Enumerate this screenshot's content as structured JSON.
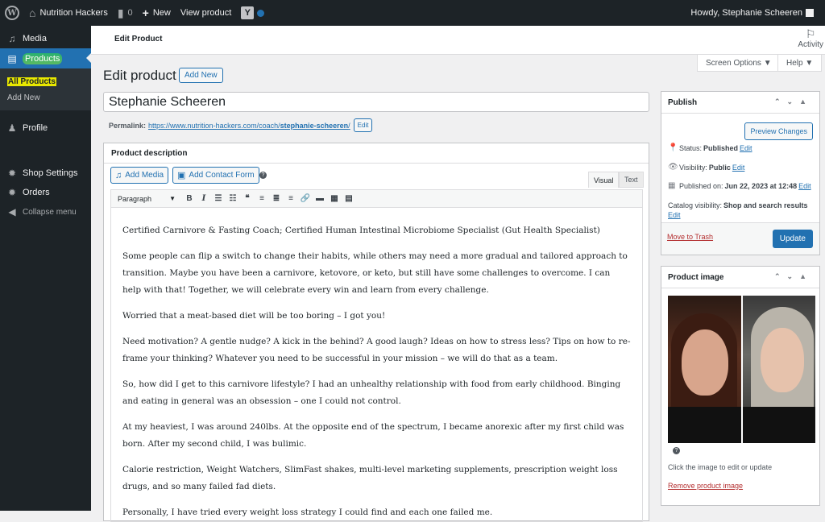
{
  "admin_bar": {
    "site_name": "Nutrition Hackers",
    "comments_count": "0",
    "new_label": "New",
    "view_label": "View product",
    "howdy": "Howdy, Stephanie Scheeren"
  },
  "sidebar": {
    "media": "Media",
    "products": "Products",
    "all_products": "All Products",
    "add_new": "Add New",
    "profile": "Profile",
    "shop_settings": "Shop Settings",
    "orders": "Orders",
    "collapse": "Collapse menu"
  },
  "top": {
    "title": "Edit Product",
    "activity": "Activity",
    "screen_options": "Screen Options ▼",
    "help": "Help ▼"
  },
  "heading": {
    "title": "Edit product",
    "add_new": "Add New"
  },
  "product": {
    "name": "Stephanie Scheeren",
    "permalink_label": "Permalink:",
    "permalink_base": "https://www.nutrition-hackers.com/coach/",
    "permalink_slug": "stephanie-scheeren",
    "permalink_end": "/",
    "edit": "Edit"
  },
  "editor": {
    "box_title": "Product description",
    "add_media": "Add Media",
    "add_contact_form": "Add Contact Form",
    "tab_visual": "Visual",
    "tab_text": "Text",
    "format": "Paragraph",
    "paragraphs": [
      "Certified Carnivore & Fasting Coach; Certified Human Intestinal Microbiome Specialist (Gut Health Specialist)",
      "Some people can flip a switch to change their habits, while others may need a more gradual and tailored approach to transition. Maybe you have been a carnivore, ketovore, or keto, but still have some challenges to overcome. I can help with that! Together, we will celebrate every win and learn from every challenge.",
      "Worried that a meat-based diet will be too boring – I got you!",
      "Need motivation? A gentle nudge? A kick in the behind? A good laugh? Ideas on how to stress less? Tips on how to re-frame your thinking? Whatever you need to be successful in your mission – we will do that as a team.",
      "So, how did I get to this carnivore lifestyle? I had an unhealthy relationship with food from early childhood. Binging and eating in general was an obsession – one I could not control.",
      "At my heaviest, I was around 240lbs. At the opposite end of the spectrum, I became anorexic after my first child was born. After my second child, I was bulimic.",
      "Calorie restriction, Weight Watchers, SlimFast shakes, multi-level marketing supplements, prescription weight loss drugs, and so many failed fad diets.",
      "Personally, I have tried every weight loss strategy I could find and each one failed me."
    ]
  },
  "publish": {
    "title": "Publish",
    "preview": "Preview Changes",
    "status_label": "Status:",
    "status_value": "Published",
    "visibility_label": "Visibility:",
    "visibility_value": "Public",
    "published_label": "Published on:",
    "published_value": "Jun 22, 2023 at 12:48",
    "catalog_label": "Catalog visibility:",
    "catalog_value": "Shop and search results",
    "edit": "Edit",
    "trash": "Move to Trash",
    "update": "Update"
  },
  "product_image": {
    "title": "Product image",
    "hint": "Click the image to edit or update",
    "remove": "Remove product image"
  }
}
